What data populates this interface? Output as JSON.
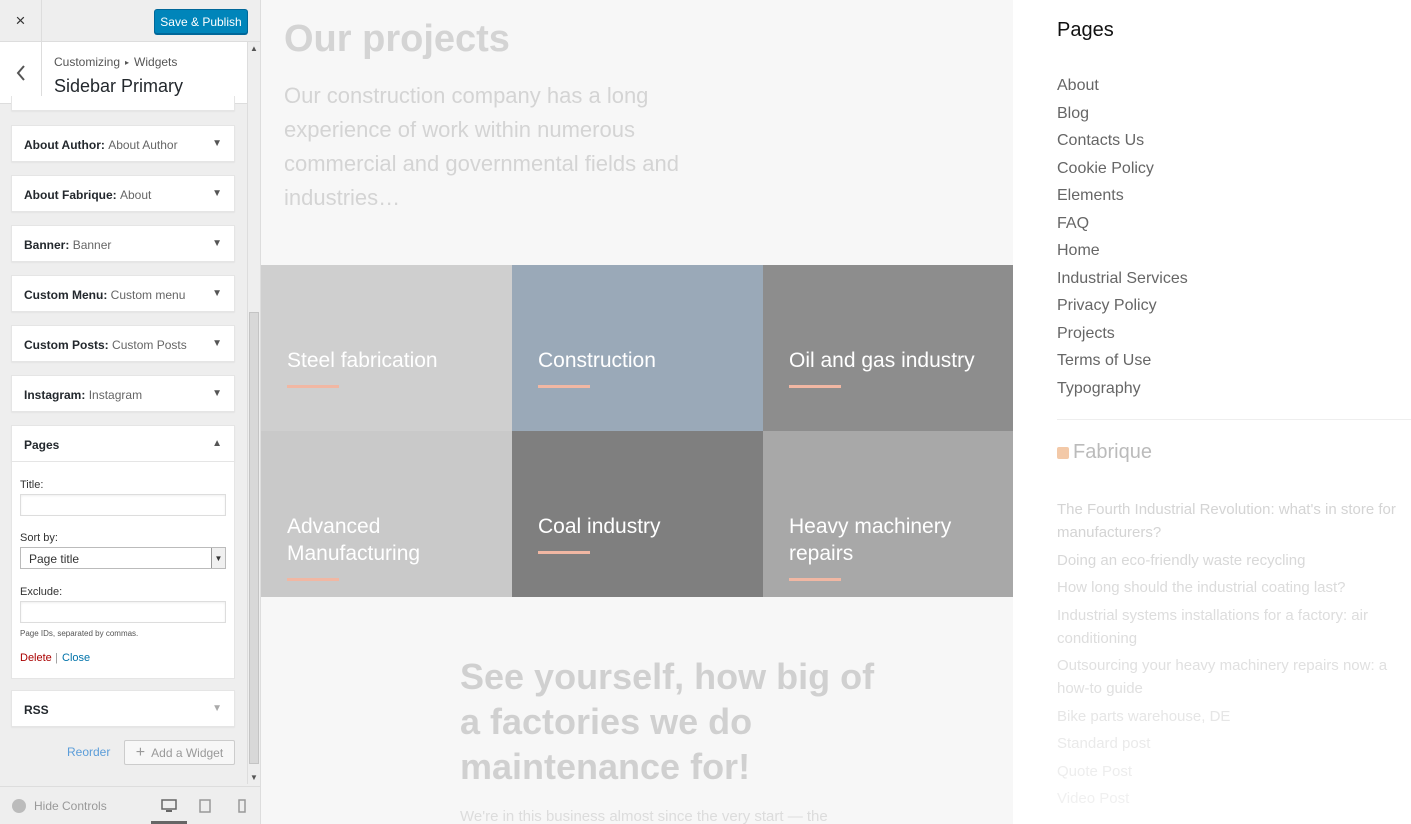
{
  "customizer": {
    "close_icon": "×",
    "publish_label": "Save & Publish",
    "breadcrumb": [
      "Customizing",
      "Widgets"
    ],
    "panel_title": "Sidebar Primary",
    "widgets": [
      {
        "name": "About Author:",
        "title": "About Author",
        "expanded": false
      },
      {
        "name": "About Fabrique:",
        "title": "About",
        "expanded": false
      },
      {
        "name": "Banner:",
        "title": "Banner",
        "expanded": false
      },
      {
        "name": "Custom Menu:",
        "title": "Custom menu",
        "expanded": false
      },
      {
        "name": "Custom Posts:",
        "title": "Custom Posts",
        "expanded": false
      },
      {
        "name": "Instagram:",
        "title": "Instagram",
        "expanded": false
      },
      {
        "name": "Pages",
        "title": "",
        "expanded": true
      },
      {
        "name": "RSS",
        "title": "",
        "expanded": false
      }
    ],
    "pages_form": {
      "title_label": "Title:",
      "title_value": "",
      "sortby_label": "Sort by:",
      "sortby_value": "Page title",
      "exclude_label": "Exclude:",
      "exclude_value": "",
      "exclude_help": "Page IDs, separated by commas.",
      "delete_label": "Delete",
      "separator": "|",
      "close_label": "Close"
    },
    "reorder_label": "Reorder",
    "add_widget_label": "Add a Widget",
    "hide_controls_label": "Hide Controls",
    "devices": [
      "desktop-icon",
      "tablet-icon",
      "mobile-icon"
    ]
  },
  "preview": {
    "projects_title": "Our projects",
    "projects_intro": "Our construction company has a long experience of work within numerous commercial and governmental fields and industries…",
    "tiles": [
      {
        "title": "Steel fabrication",
        "color": "#cfcfcf"
      },
      {
        "title": "Construction",
        "color": "#9aa9b8"
      },
      {
        "title": "Oil and gas industry",
        "color": "#8d8d8d"
      },
      {
        "title": "Advanced Manufacturing",
        "color": "#c9c9c9"
      },
      {
        "title": "Coal industry",
        "color": "#7f7f7f"
      },
      {
        "title": "Heavy machinery repairs",
        "color": "#a8a8a8"
      }
    ],
    "maintenance_title": "See yourself, how big of a factories we do maintenance for!",
    "maintenance_text": "We're in this business almost since the very start — the",
    "sidebar": {
      "pages_heading": "Pages",
      "pages": [
        "About",
        "Blog",
        "Contacts Us",
        "Cookie Policy",
        "Elements",
        "FAQ",
        "Home",
        "Industrial Services",
        "Privacy Policy",
        "Projects",
        "Terms of Use",
        "Typography"
      ],
      "rss_heading": "Fabrique",
      "rss_items": [
        {
          "text": "The Fourth Industrial Revolution: what's in store for manufacturers?",
          "color": "#d4d4d4"
        },
        {
          "text": "Doing an eco-friendly waste recycling",
          "color": "#d8d8d8"
        },
        {
          "text": "How long should the industrial coating last?",
          "color": "#dbdbdb"
        },
        {
          "text": "Industrial systems installations for a factory: air conditioning",
          "color": "#dddddd"
        },
        {
          "text": "Outsourcing your heavy machinery repairs now: a how-to guide",
          "color": "#e0e0e0"
        },
        {
          "text": "Bike parts warehouse, DE",
          "color": "#e6e6e6"
        },
        {
          "text": "Standard post",
          "color": "#eaeaea"
        },
        {
          "text": "Quote Post",
          "color": "#ededed"
        },
        {
          "text": "Video Post",
          "color": "#f0f0f0"
        }
      ]
    }
  }
}
